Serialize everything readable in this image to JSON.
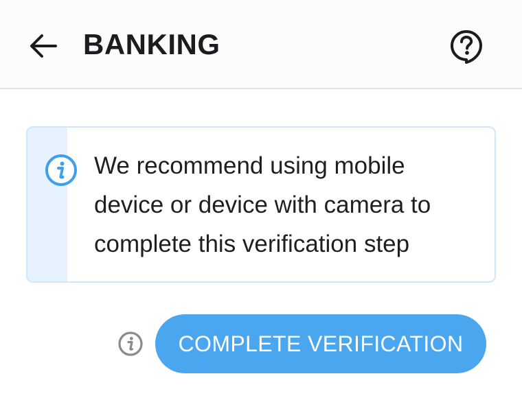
{
  "header": {
    "title": "BANKING",
    "back_icon": "arrow-left-icon",
    "help_icon": "help-bubble-icon"
  },
  "info_banner": {
    "icon": "info-icon",
    "message": "We recommend using mobile device or device with camera to complete this verification step",
    "accent_color": "#3f9fe8"
  },
  "actions": {
    "info_icon": "info-icon",
    "complete_label": "COMPLETE VERIFICATION",
    "button_color": "#4aa7ef"
  }
}
